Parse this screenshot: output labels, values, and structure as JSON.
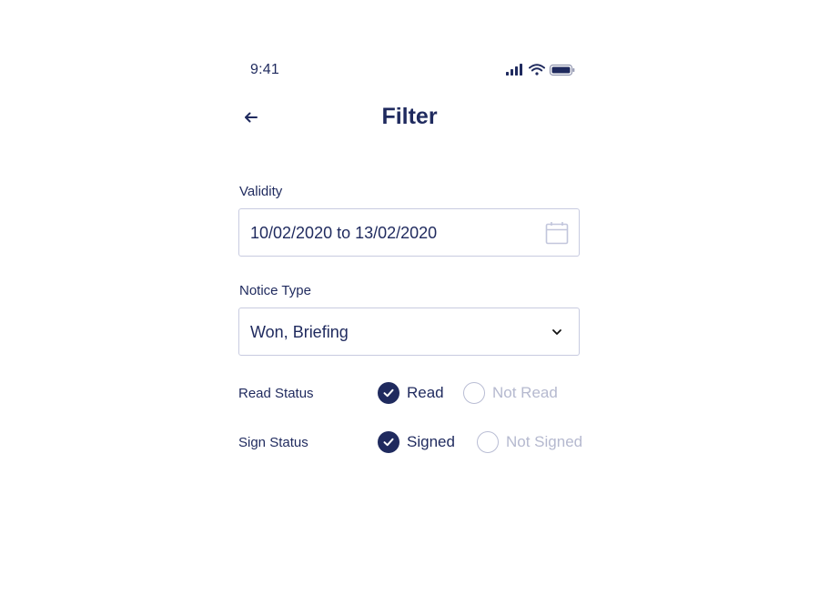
{
  "status_bar": {
    "time": "9:41",
    "icons": [
      "signal-icon",
      "wifi-icon",
      "battery-icon"
    ]
  },
  "header": {
    "back_icon": "arrow-left-icon",
    "title": "Filter"
  },
  "validity": {
    "label": "Validity",
    "value": "10/02/2020 to 13/02/2020",
    "icon": "calendar-icon"
  },
  "notice_type": {
    "label": "Notice Type",
    "value": "Won, Briefing",
    "icon": "chevron-down-icon"
  },
  "read_status": {
    "label": "Read Status",
    "options": [
      {
        "label": "Read",
        "selected": true
      },
      {
        "label": "Not Read",
        "selected": false
      }
    ]
  },
  "sign_status": {
    "label": "Sign Status",
    "options": [
      {
        "label": "Signed",
        "selected": true
      },
      {
        "label": "Not Signed",
        "selected": false
      }
    ]
  },
  "colors": {
    "primary": "#1f2a5e",
    "border": "#c8cbe0",
    "disabled_text": "#b5b9cf"
  }
}
